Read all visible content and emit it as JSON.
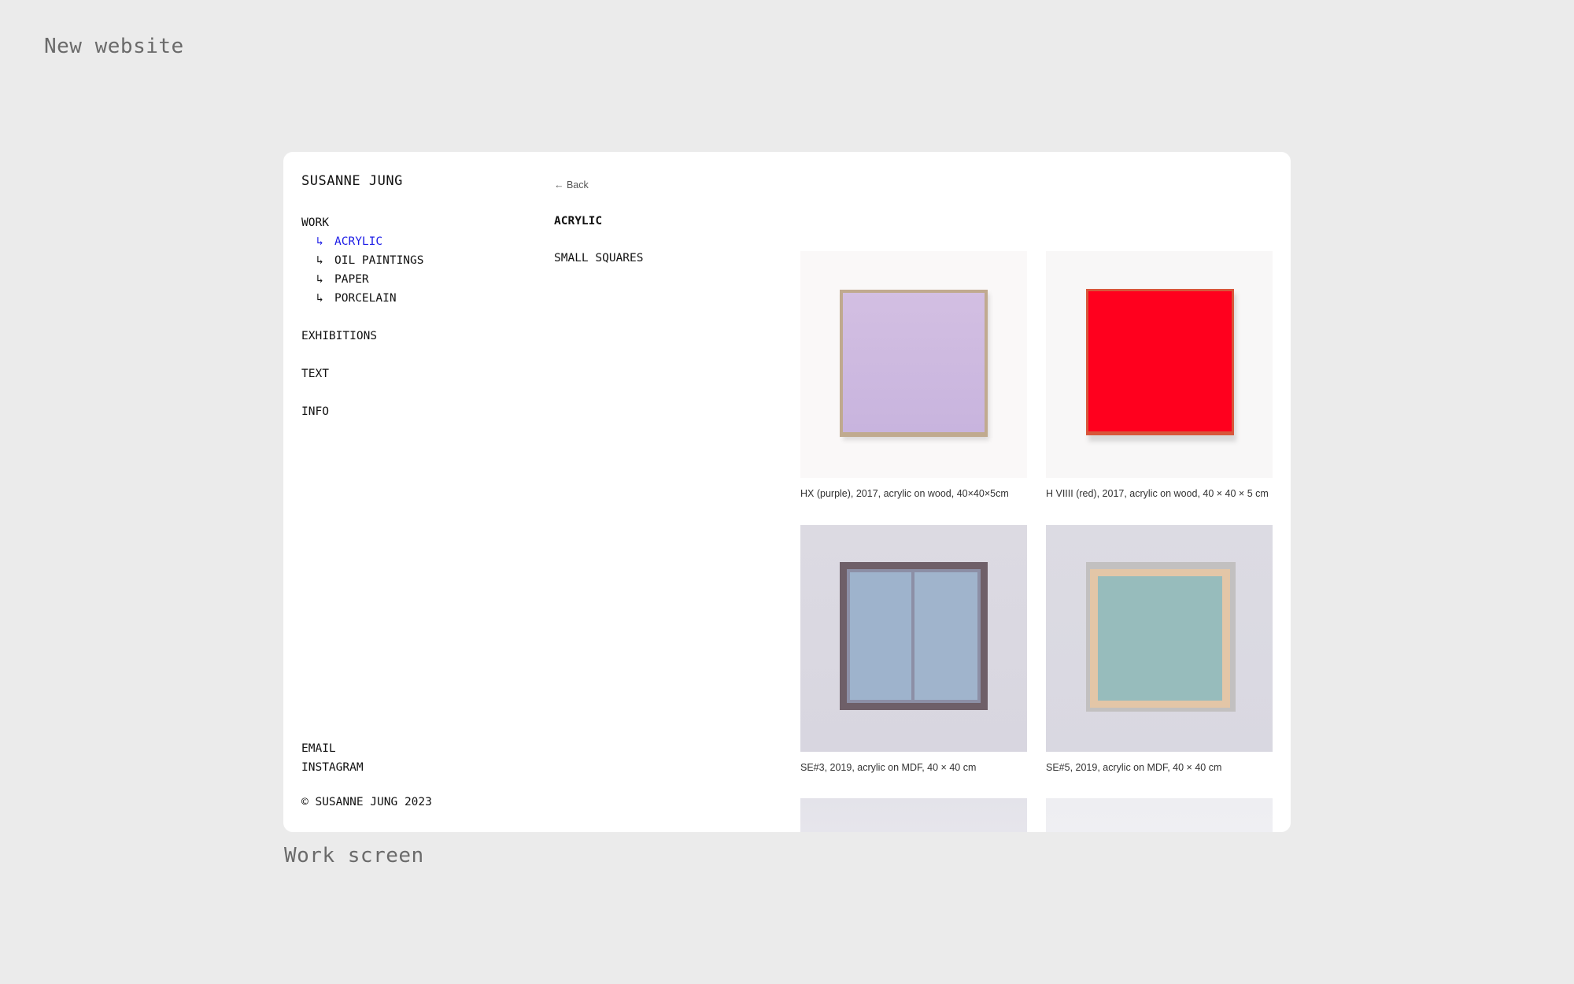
{
  "board": {
    "page_label": "New website",
    "screen_caption": "Work screen"
  },
  "site": {
    "title": "SUSANNE JUNG",
    "copyright": "© SUSANNE JUNG 2023"
  },
  "nav": {
    "work": "WORK",
    "arrow": "↳",
    "sub": {
      "acrylic": "ACRYLIC",
      "oil": "OIL PAINTINGS",
      "paper": "PAPER",
      "porcelain": "PORCELAIN"
    },
    "exhibitions": "EXHIBITIONS",
    "text": "TEXT",
    "info": "INFO",
    "email": "EMAIL",
    "instagram": "INSTAGRAM"
  },
  "content": {
    "back": "← Back",
    "section_title": "ACRYLIC",
    "subsection": "SMALL SQUARES"
  },
  "gallery": {
    "items": [
      {
        "caption": "HX (purple), 2017, acrylic on wood, 40×40×5cm"
      },
      {
        "caption": "H VIIII (red), 2017, acrylic on wood, 40 × 40 × 5 cm"
      },
      {
        "caption": "SE#3, 2019, acrylic on MDF, 40 × 40 cm"
      },
      {
        "caption": "SE#5, 2019, acrylic on MDF, 40 × 40 cm"
      }
    ]
  },
  "colors": {
    "background": "#ebebeb",
    "active_link": "#1a1ae6",
    "text": "#111111"
  }
}
